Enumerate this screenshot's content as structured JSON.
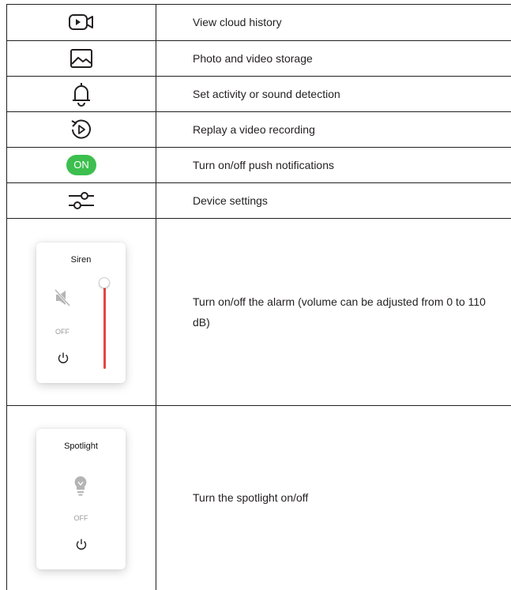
{
  "rows": [
    {
      "icon": "camera-cloud-icon",
      "text": "View cloud history"
    },
    {
      "icon": "image-icon",
      "text": "Photo and video storage"
    },
    {
      "icon": "bell-icon",
      "text": "Set activity or sound detection"
    },
    {
      "icon": "replay-icon",
      "text": "Replay a video recording"
    },
    {
      "icon": "on-toggle",
      "label": "ON",
      "text": "Turn on/off push notifications",
      "color": "#3cbf4e"
    },
    {
      "icon": "sliders-icon",
      "text": "Device settings"
    },
    {
      "card": {
        "title": "Siren",
        "status": "OFF",
        "icon": "speaker-muted-icon",
        "volume_fraction": 1.0,
        "slider_color": "#e64543"
      },
      "text": "Turn on/off the alarm (volume can be adjusted from 0 to 110 dB)"
    },
    {
      "card": {
        "title": "Spotlight",
        "status": "OFF",
        "icon": "lightbulb-icon"
      },
      "text": "Turn the spotlight on/off"
    }
  ]
}
